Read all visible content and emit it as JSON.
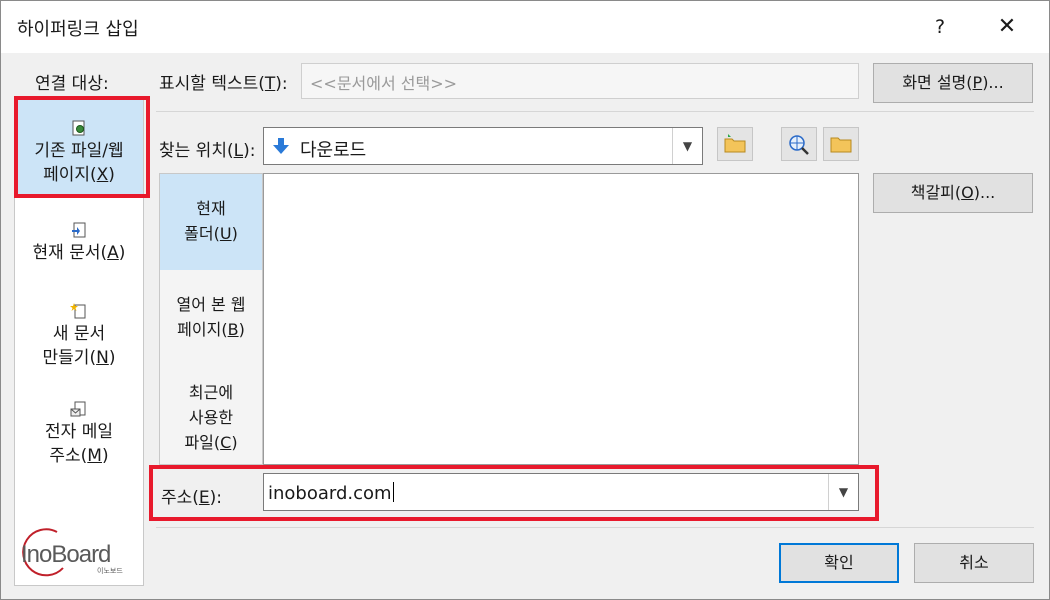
{
  "dialog": {
    "title": "하이퍼링크 삽입",
    "help": "?",
    "close": "✕"
  },
  "link_to": {
    "label": "연결 대상:",
    "items": [
      {
        "text": "기존 파일/웹 페이지",
        "mnemonic": "X",
        "selected": true
      },
      {
        "text": "현재 문서",
        "mnemonic": "A"
      },
      {
        "text": "새 문서 만들기",
        "mnemonic": "N"
      },
      {
        "text": "전자 메일 주소",
        "mnemonic": "M"
      }
    ]
  },
  "text_to_display": {
    "label": "표시할 텍스트",
    "mnemonic": "T",
    "value": "<<문서에서 선택>>"
  },
  "screentip_button": {
    "label": "화면 설명",
    "mnemonic": "P"
  },
  "look_in": {
    "label": "찾는 위치",
    "mnemonic": "L",
    "value": "다운로드"
  },
  "side_tabs": [
    {
      "line1": "현재",
      "line2": "폴더",
      "mnemonic": "U",
      "selected": true
    },
    {
      "line1": "열어 본 웹",
      "line2": "페이지",
      "mnemonic": "B"
    },
    {
      "line1": "최근에",
      "line2": "사용한",
      "line3": "파일",
      "mnemonic": "C"
    }
  ],
  "bookmark_button": {
    "label": "책갈피",
    "mnemonic": "O"
  },
  "address": {
    "label": "주소",
    "mnemonic": "E",
    "value": "inoboard.com"
  },
  "buttons": {
    "ok": "확인",
    "cancel": "취소"
  },
  "logo": {
    "text": "InoBoard",
    "sub": "이노보드"
  },
  "colors": {
    "highlight": "#e8192c",
    "selected": "#cce4f7",
    "accent": "#0078d7"
  }
}
